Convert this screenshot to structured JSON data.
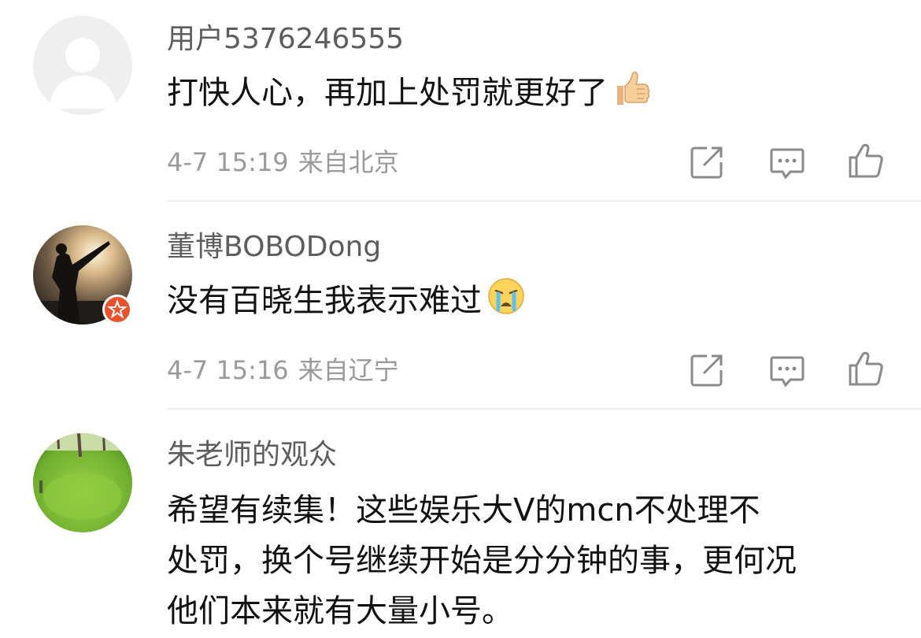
{
  "comments": [
    {
      "username": "用户5376246555",
      "content_lines": [
        "打快人心，再加上处罚就更好了"
      ],
      "emoji": "thumbs-up-emoji",
      "time": "4-7 15:19",
      "location": "来自北京",
      "avatar": "default-avatar"
    },
    {
      "username": "董博BOBODong",
      "content_lines": [
        "没有百晓生我表示难过"
      ],
      "emoji": "crying-emoji",
      "time": "4-7 15:16",
      "location": "来自辽宁",
      "avatar": "photo-avatar-sunset",
      "verified": true
    },
    {
      "username": "朱老师的观众",
      "content_lines": [
        "希望有续集！这些娱乐大V的mcn不处理不",
        "处罚，换个号继续开始是分分钟的事，更何况",
        "他们本来就有大量小号。"
      ],
      "avatar": "photo-avatar-green"
    }
  ],
  "icons": {
    "repost": "repost-icon",
    "comment": "comment-icon",
    "like": "like-icon"
  },
  "colors": {
    "username": "#5d5d5d",
    "meta": "#9a9a9a",
    "icon": "#8a8a8a",
    "verified_badge": "#e8532d"
  }
}
